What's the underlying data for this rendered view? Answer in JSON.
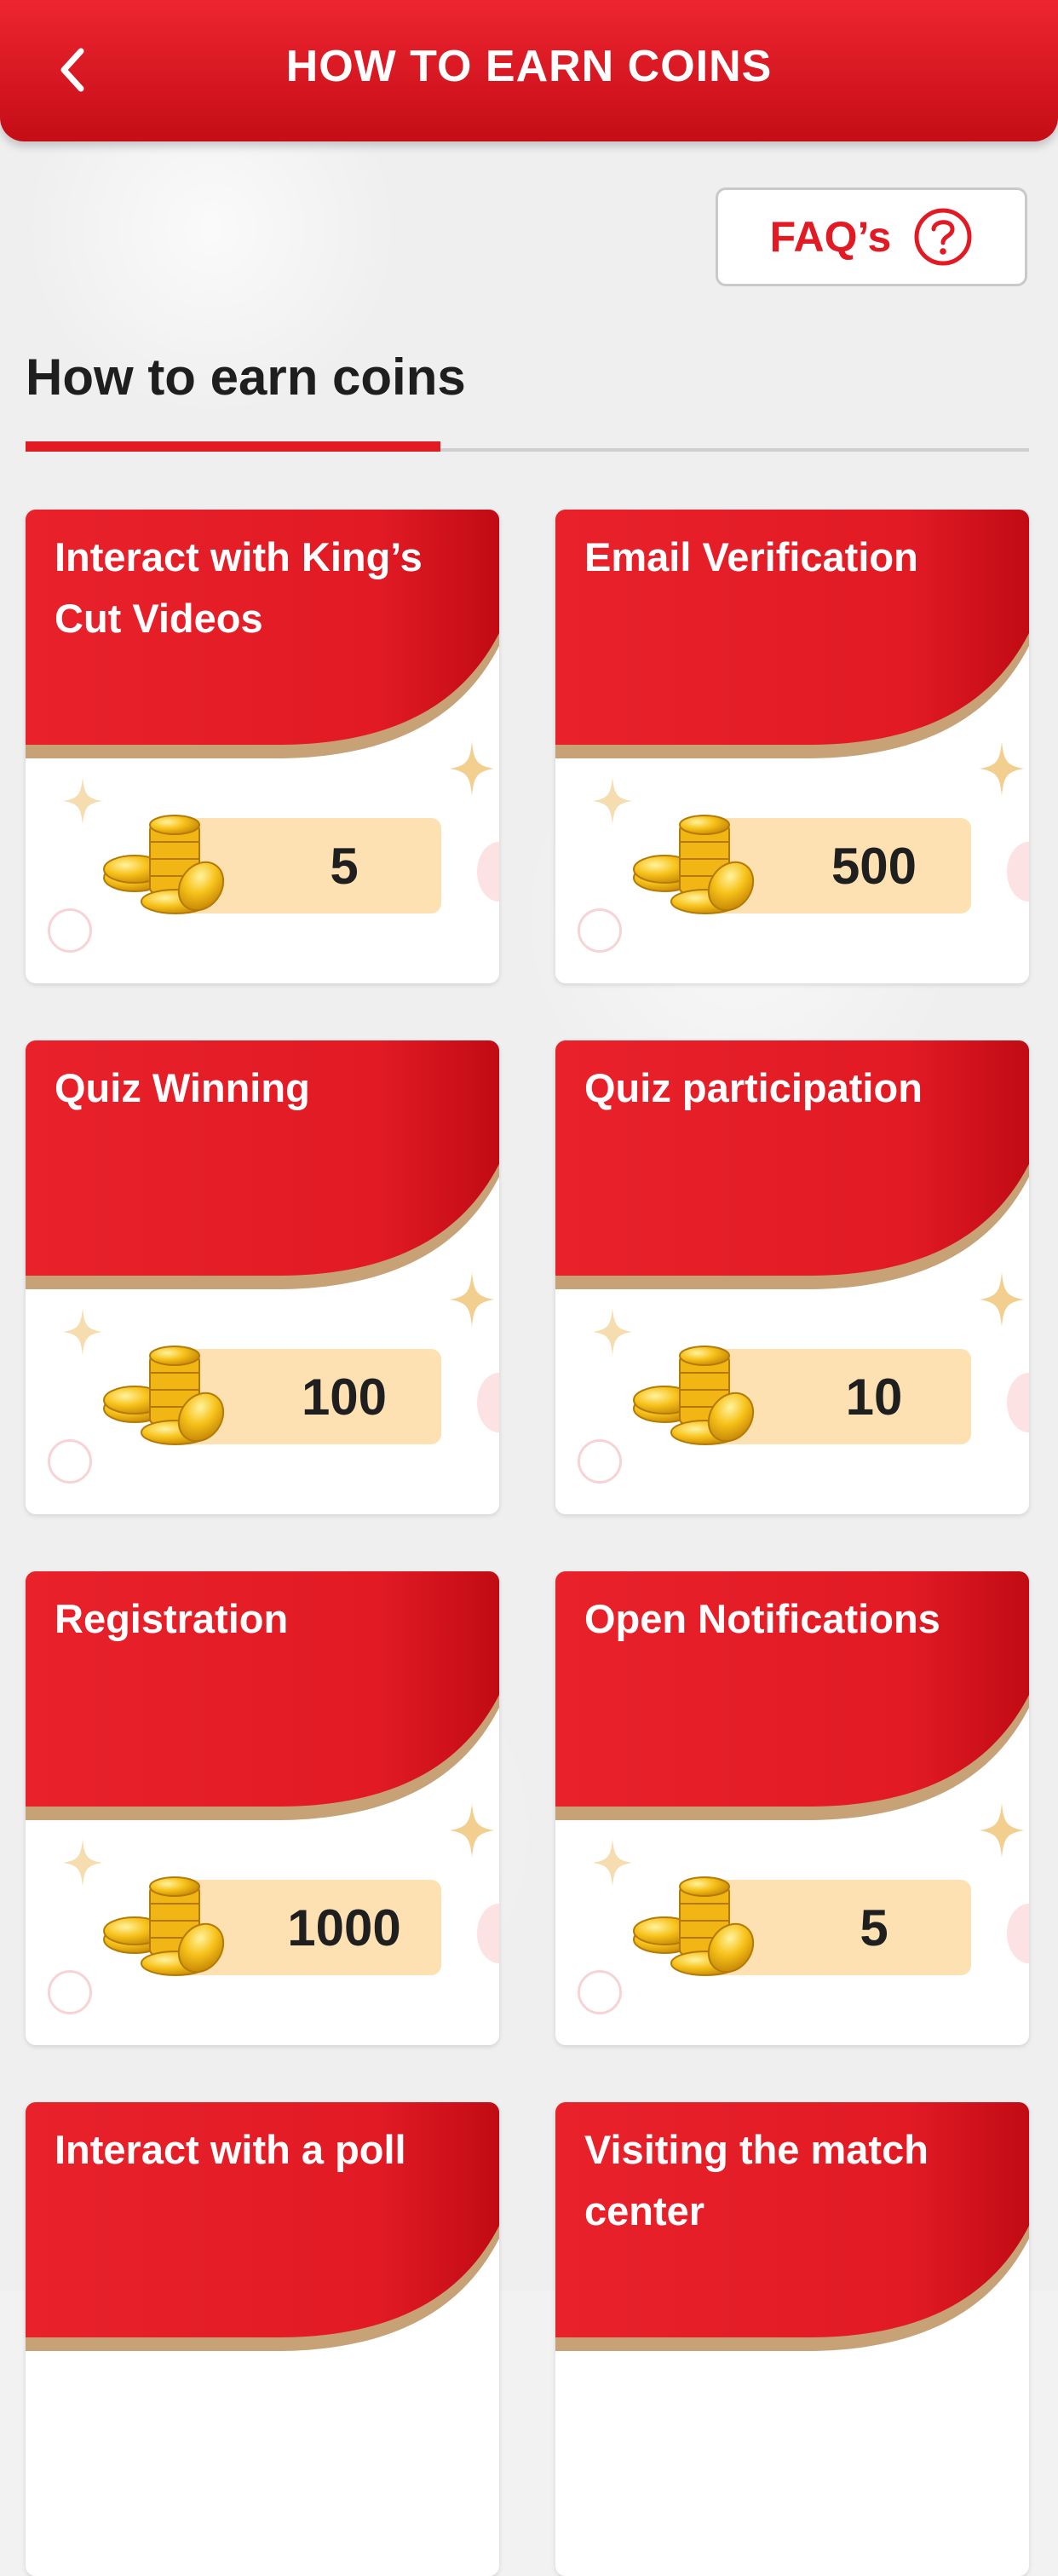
{
  "header": {
    "title": "HOW TO EARN COINS"
  },
  "faq": {
    "label": "FAQ’s"
  },
  "section": {
    "title": "How to earn coins"
  },
  "colors": {
    "primary_red": "#e11a24",
    "pill_bg": "#fde1b2",
    "gold_stripe": "#c7a277"
  },
  "icons": {
    "back": "chevron-left-icon",
    "faq": "question-circle-icon",
    "coins": "coin-stack-icon",
    "sparkle": "sparkle-icon"
  },
  "cards": [
    {
      "title": "Interact with King’s Cut Videos",
      "coins": "5"
    },
    {
      "title": "Email Verification",
      "coins": "500"
    },
    {
      "title": "Quiz Winning",
      "coins": "100"
    },
    {
      "title": "Quiz participation",
      "coins": "10"
    },
    {
      "title": "Registration",
      "coins": "1000"
    },
    {
      "title": "Open Notifications",
      "coins": "5"
    },
    {
      "title": "Interact with a poll",
      "coins": ""
    },
    {
      "title": "Visiting the match center",
      "coins": ""
    }
  ]
}
